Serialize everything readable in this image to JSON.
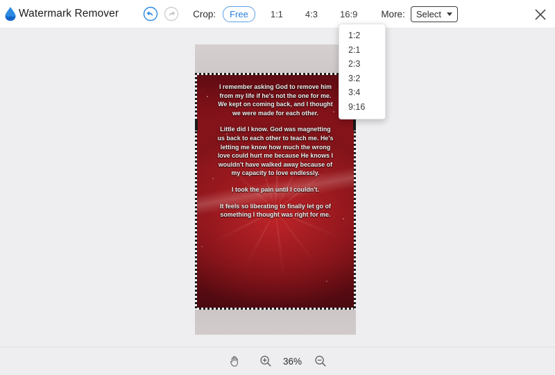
{
  "header": {
    "brand": "Watermark Remover",
    "logo_icon": "water-drop-logo",
    "undo_icon": "undo-circle-icon",
    "redo_icon": "redo-circle-icon",
    "crop_label": "Crop:",
    "ratios": [
      {
        "label": "Free",
        "active": true
      },
      {
        "label": "1:1",
        "active": false
      },
      {
        "label": "4:3",
        "active": false
      },
      {
        "label": "16:9",
        "active": false
      }
    ],
    "more_label": "More:",
    "select_value": "Select",
    "caret_icon": "chevron-down-icon",
    "close_icon": "close-icon"
  },
  "dropdown": {
    "open": true,
    "items": [
      "1:2",
      "2:1",
      "2:3",
      "3:2",
      "3:4",
      "9:16"
    ]
  },
  "image": {
    "quote": [
      "I remember asking God to remove him from my life if he's not the one for me. We kept on coming back, and I thought we were made for each other.",
      "Little did I know. God was magnetting us back to each other to teach me. He's letting me know how much the wrong love could hurt me because He knows I wouldn't have walked away because of my capacity to love endlessly.",
      "I took the pain until I couldn't.",
      "It feels so liberating to finally let go of something I thought was right for me."
    ]
  },
  "footer": {
    "pan_icon": "hand-pan-icon",
    "zoom_in_icon": "zoom-in-icon",
    "zoom_level": "36%",
    "zoom_out_icon": "zoom-out-icon"
  },
  "colors": {
    "accent": "#2a7fe0",
    "canvas_bg": "#eeeef0",
    "header_bg": "#ffffff"
  }
}
